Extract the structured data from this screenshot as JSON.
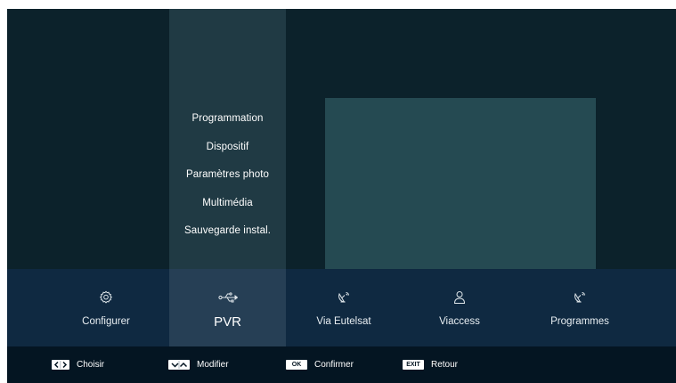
{
  "submenu": {
    "items": [
      {
        "label": "Programmation"
      },
      {
        "label": "Dispositif"
      },
      {
        "label": "Paramètres photo"
      },
      {
        "label": "Multimédia"
      },
      {
        "label": "Sauvegarde instal."
      }
    ]
  },
  "main_menu": {
    "items": [
      {
        "label": "Configurer",
        "icon": "gear-icon"
      },
      {
        "label": "PVR",
        "icon": "usb-icon",
        "active": true
      },
      {
        "label": "Via Eutelsat",
        "icon": "satellite-dish-icon"
      },
      {
        "label": "Viaccess",
        "icon": "user-icon"
      },
      {
        "label": "Programmes",
        "icon": "satellite-dish-icon"
      }
    ]
  },
  "help_bar": {
    "choose": {
      "key": "left-right-arrows",
      "label": "Choisir"
    },
    "modify": {
      "key": "down-up-arrows",
      "label": "Modifier"
    },
    "confirm": {
      "key": "OK",
      "label": "Confirmer"
    },
    "back": {
      "key": "EXIT",
      "label": "Retour"
    }
  },
  "colors": {
    "background": "#0c222b",
    "submenu_column": "#203a44",
    "preview": "#254a52",
    "menu_bar": "#0f2941",
    "menu_active": "#263f55",
    "help_bar": "#041522"
  }
}
